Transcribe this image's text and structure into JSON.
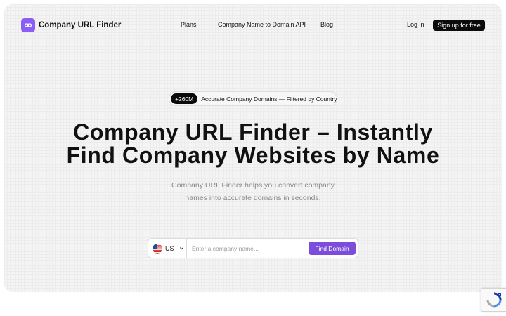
{
  "brand": {
    "name": "Company URL Finder",
    "logo_icon": "link-icon",
    "accent": "#8b5cf6"
  },
  "nav": {
    "links": [
      "Plans",
      "Company Name to Domain API",
      "Blog"
    ],
    "login": "Log in",
    "signup": "Sign up for free"
  },
  "hero": {
    "badge": "+260M",
    "badge_text": "Accurate Company Domains — Filtered by Country",
    "headline_line1": "Company URL Finder – Instantly",
    "headline_line2": "Find Company Websites by Name",
    "subheadline_line1": "Company URL Finder helps you convert company",
    "subheadline_line2": "names into accurate domains in seconds."
  },
  "search": {
    "country_code": "US",
    "country_flag_icon": "us-flag-icon",
    "placeholder": "Enter a company name...",
    "value": "",
    "button": "Find Domain",
    "button_color": "#7c4ddb"
  },
  "recaptcha": {
    "icon": "recaptcha-icon"
  }
}
